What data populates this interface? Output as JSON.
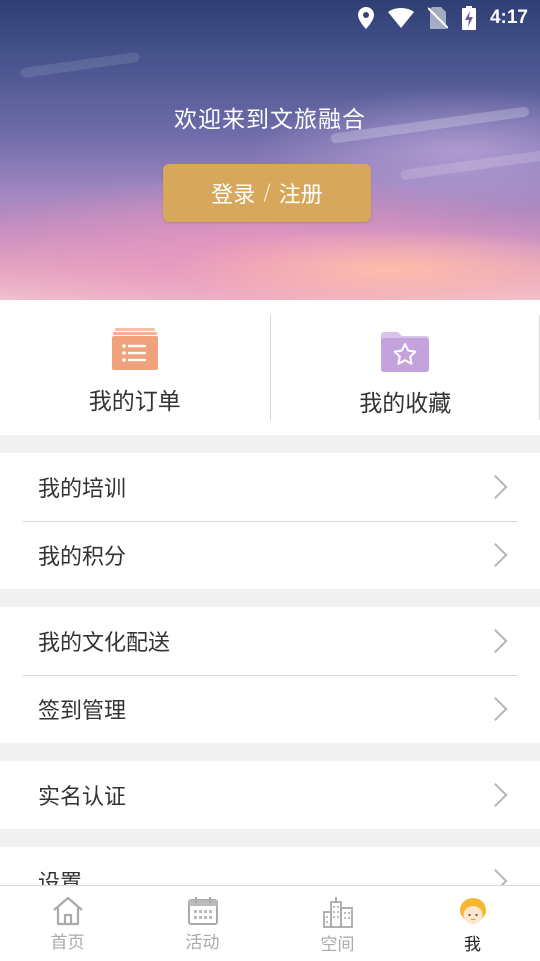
{
  "status_bar": {
    "time": "4:17",
    "icons": [
      "location-icon",
      "wifi-icon",
      "no-sim-icon",
      "battery-charging-icon"
    ]
  },
  "hero": {
    "welcome_text": "欢迎来到文旅融合",
    "login_label": "登录",
    "separator": "/",
    "register_label": "注册",
    "button_color": "#d7a75b"
  },
  "quick_actions": [
    {
      "label": "我的订单",
      "icon": "orders-icon",
      "color": "#f0a27c"
    },
    {
      "label": "我的收藏",
      "icon": "favorites-icon",
      "color": "#c4a3dd"
    }
  ],
  "menu": {
    "training": "我的培训",
    "points": "我的积分",
    "culture_delivery": "我的文化配送",
    "checkin": "签到管理",
    "real_name": "实名认证",
    "settings": "设置"
  },
  "bottom_nav": {
    "items": [
      {
        "label": "首页",
        "icon": "home-icon"
      },
      {
        "label": "活动",
        "icon": "calendar-icon"
      },
      {
        "label": "空间",
        "icon": "buildings-icon"
      },
      {
        "label": "我",
        "icon": "user-avatar-icon"
      }
    ],
    "active": "我",
    "active_color": "#f5b731"
  }
}
